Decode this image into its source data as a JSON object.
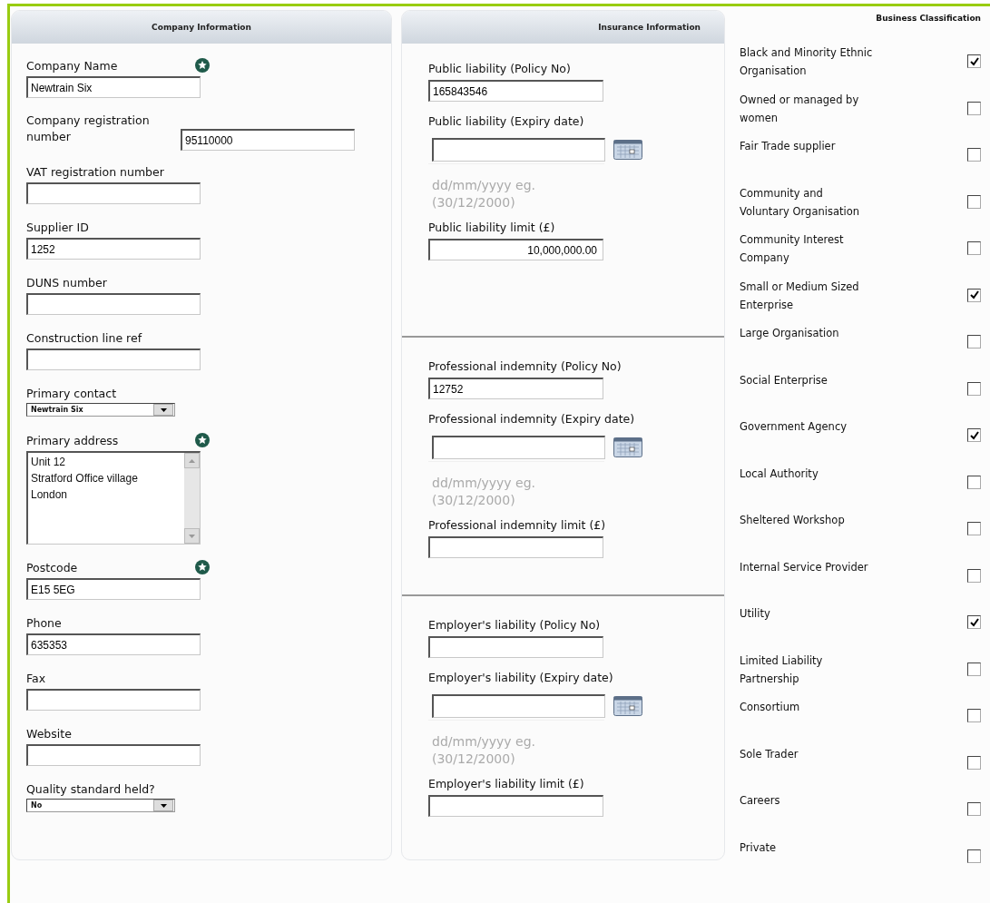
{
  "company": {
    "title": "Company Information",
    "fields": [
      {
        "kind": "text",
        "label": "Company Name",
        "value": "Newtrain Six",
        "required": true
      },
      {
        "kind": "side",
        "label": "Company registration number",
        "value": "95110000",
        "required": false
      },
      {
        "kind": "text",
        "label": "VAT registration number",
        "required": false
      },
      {
        "kind": "text",
        "label": "Supplier ID",
        "value": "1252",
        "required": false
      },
      {
        "kind": "text",
        "label": "DUNS number",
        "required": false
      },
      {
        "kind": "text",
        "label": "Construction line ref",
        "required": false
      },
      {
        "kind": "select",
        "label": "Primary contact",
        "value": "Newtrain Six",
        "required": false
      },
      {
        "kind": "textarea",
        "label": "Primary address",
        "value": "Unit 12\nStratford Office village\nLondon",
        "required": true
      },
      {
        "kind": "text",
        "label": "Postcode",
        "value": "E15 5EG",
        "required": true
      },
      {
        "kind": "text",
        "label": "Phone",
        "value": "635353",
        "required": false
      },
      {
        "kind": "text",
        "label": "Fax",
        "required": false
      },
      {
        "kind": "text",
        "label": "Website",
        "required": false
      },
      {
        "kind": "select",
        "label": "Quality standard held?",
        "value": "No",
        "required": false
      }
    ]
  },
  "insurance": {
    "title": "Insurance Information",
    "groups": [
      {
        "fields": [
          {
            "kind": "text",
            "label": "Public liability (Policy No)",
            "value": "165843546"
          },
          {
            "kind": "date",
            "label": "Public liability (Expiry date)",
            "hint": "dd/mm/yyyy eg. (30/12/2000)"
          },
          {
            "kind": "money",
            "label": "Public liability limit (£)",
            "value": "10,000,000.00"
          }
        ]
      },
      {
        "fields": [
          {
            "kind": "text",
            "label": "Professional indemnity (Policy No)",
            "value": "12752"
          },
          {
            "kind": "date",
            "label": "Professional indemnity (Expiry date)",
            "hint": "dd/mm/yyyy eg. (30/12/2000)"
          },
          {
            "kind": "money",
            "label": "Professional indemnity limit (£)"
          }
        ]
      },
      {
        "fields": [
          {
            "kind": "text",
            "label": "Employer's liability (Policy No)"
          },
          {
            "kind": "date",
            "label": "Employer's liability (Expiry date)",
            "hint": "dd/mm/yyyy eg. (30/12/2000)"
          },
          {
            "kind": "money",
            "label": "Employer's liability limit (£)"
          }
        ]
      }
    ]
  },
  "classification": {
    "title": "Business Classification",
    "items": [
      {
        "label": "Black and Minority Ethnic Organisation",
        "checked": true
      },
      {
        "label": "Owned or managed by women",
        "checked": false
      },
      {
        "label": "Fair Trade supplier",
        "checked": false
      },
      {
        "label": "Community and Voluntary Organisation",
        "checked": false
      },
      {
        "label": "Community Interest Company",
        "checked": false
      },
      {
        "label": "Small or Medium Sized Enterprise",
        "checked": true
      },
      {
        "label": "Large Organisation",
        "checked": false
      },
      {
        "label": "Social Enterprise",
        "checked": false
      },
      {
        "label": "Government Agency",
        "checked": true
      },
      {
        "label": "Local Authority",
        "checked": false
      },
      {
        "label": "Sheltered Workshop",
        "checked": false
      },
      {
        "label": "Internal Service Provider",
        "checked": false
      },
      {
        "label": "Utility",
        "checked": true
      },
      {
        "label": "Limited Liability Partnership",
        "checked": false
      },
      {
        "label": "Consortium",
        "checked": false
      },
      {
        "label": "Sole Trader",
        "checked": false
      },
      {
        "label": "Careers",
        "checked": false
      },
      {
        "label": "Private",
        "checked": false
      }
    ]
  }
}
